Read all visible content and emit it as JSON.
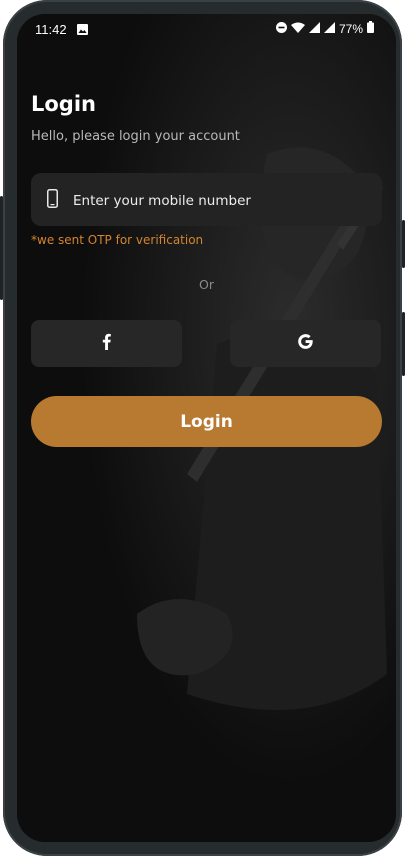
{
  "status_bar": {
    "time": "11:42",
    "battery": "77%",
    "icons": [
      "image-icon",
      "dnd-icon",
      "wifi-icon",
      "signal-icon",
      "signal-icon",
      "battery-icon"
    ]
  },
  "login": {
    "title": "Login",
    "subtitle": "Hello, please login your account",
    "mobile_placeholder": "Enter your mobile number",
    "otp_note": "*we sent OTP for verification",
    "divider_text": "Or",
    "submit_label": "Login"
  },
  "social": {
    "facebook_icon": "facebook-icon",
    "google_icon": "google-icon"
  },
  "colors": {
    "accent": "#b87930",
    "note": "#d4842e",
    "background": "#0d0d0d",
    "field": "#232323"
  }
}
